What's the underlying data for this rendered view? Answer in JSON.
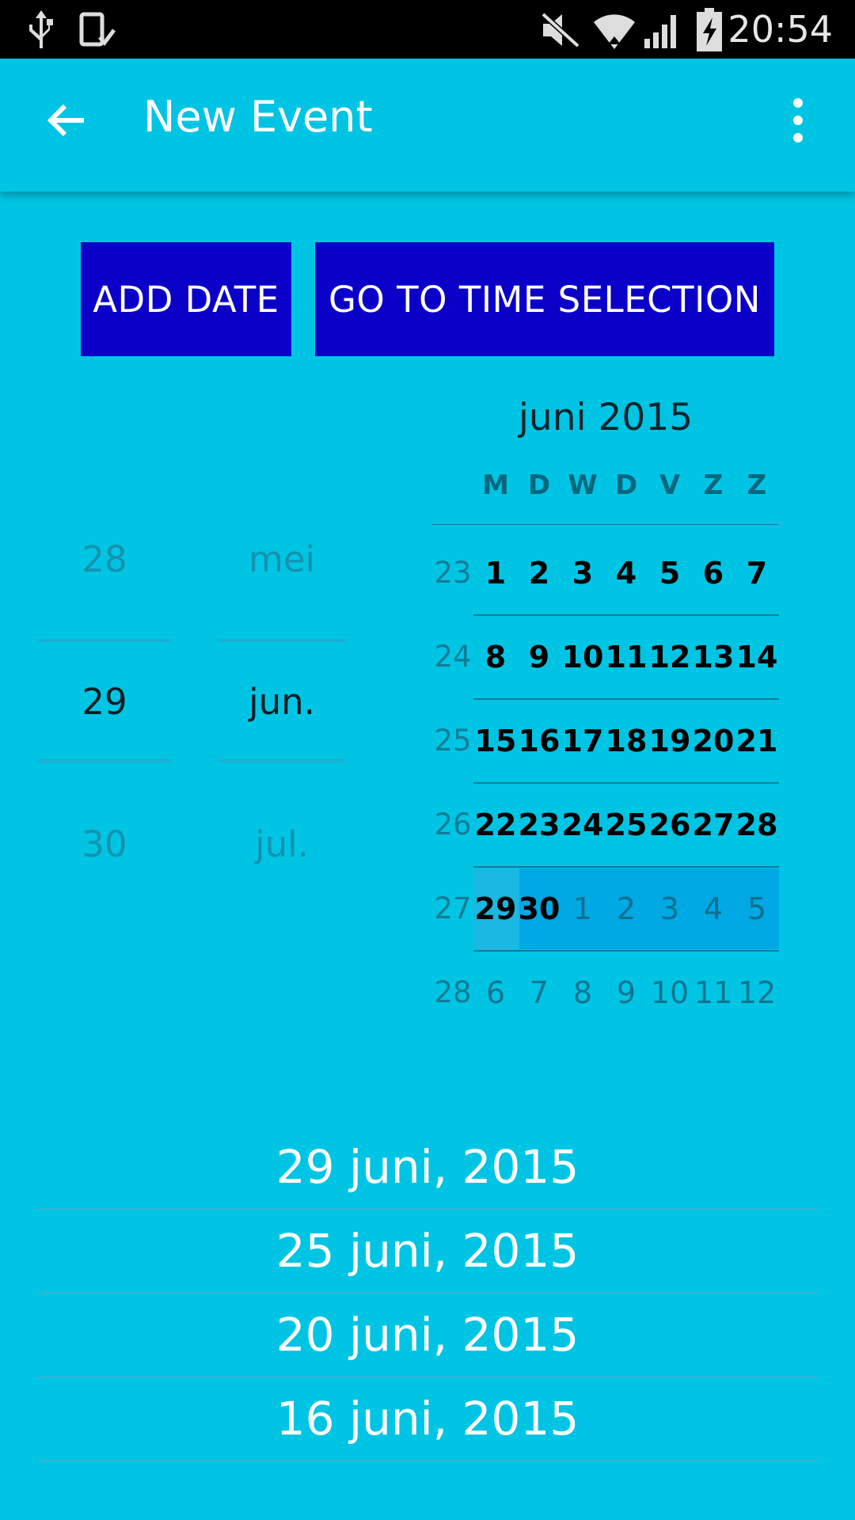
{
  "status_bar": {
    "time": "20:54",
    "icons": [
      "usb-icon",
      "screenshot-icon",
      "mute-icon",
      "wifi-icon",
      "signal-icon",
      "battery-charging-icon"
    ]
  },
  "app_bar": {
    "title": "New Event",
    "back_icon": "arrow-back-icon",
    "menu_icon": "more-vert-icon"
  },
  "buttons": {
    "add_date": "ADD DATE",
    "go_time": "GO TO TIME SELECTION"
  },
  "colors": {
    "background": "#00c4e3",
    "button": "#0a00c8",
    "selection": "#00a8e4"
  },
  "picker": {
    "day": {
      "prev": "28",
      "current": "29",
      "next": "30"
    },
    "month": {
      "prev": "mei",
      "current": "jun.",
      "next": "jul."
    }
  },
  "calendar": {
    "title": "juni 2015",
    "weekdays": [
      "M",
      "D",
      "W",
      "D",
      "V",
      "Z",
      "Z"
    ],
    "weeks": [
      {
        "num": "23",
        "days": [
          "1",
          "2",
          "3",
          "4",
          "5",
          "6",
          "7"
        ]
      },
      {
        "num": "24",
        "days": [
          "8",
          "9",
          "10",
          "11",
          "12",
          "13",
          "14"
        ]
      },
      {
        "num": "25",
        "days": [
          "15",
          "16",
          "17",
          "18",
          "19",
          "20",
          "21"
        ]
      },
      {
        "num": "26",
        "days": [
          "22",
          "23",
          "24",
          "25",
          "26",
          "27",
          "28"
        ]
      },
      {
        "num": "27",
        "days": [
          "29",
          "30",
          "1",
          "2",
          "3",
          "4",
          "5"
        ]
      },
      {
        "num": "28",
        "days": [
          "6",
          "7",
          "8",
          "9",
          "10",
          "11",
          "12"
        ]
      }
    ],
    "selected_day": "29"
  },
  "dates": [
    "29 juni, 2015",
    "25 juni, 2015",
    "20 juni, 2015",
    "16 juni, 2015"
  ]
}
